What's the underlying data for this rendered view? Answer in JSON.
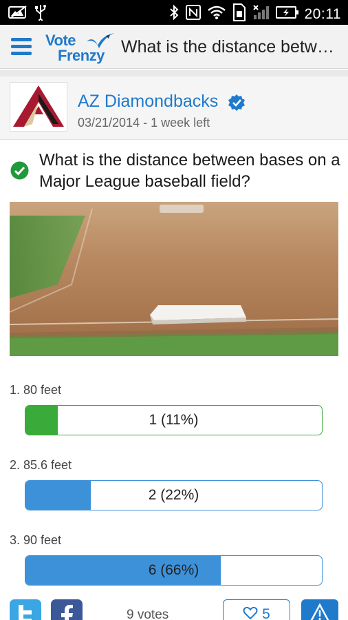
{
  "status_bar": {
    "time": "20:11",
    "left_icons": [
      "image-icon",
      "usb-icon"
    ],
    "right_icons": [
      "bluetooth-icon",
      "nfc-icon",
      "wifi-icon",
      "sim-icon",
      "signal-icon",
      "battery-charging-icon"
    ]
  },
  "app_bar": {
    "logo_line1": "Vote",
    "logo_line2": "Frenzy",
    "title": "What is the distance betwe…"
  },
  "poll": {
    "author": "AZ Diamondbacks",
    "meta": "03/21/2014 - 1 week left",
    "question": "What is the distance between bases on a Major League baseball field?",
    "options": [
      {
        "label": "1. 80 feet",
        "result": "1 (11%)",
        "fraction": 0.11,
        "color": "#3aaa3a",
        "voted": true
      },
      {
        "label": "2. 85.6 feet",
        "result": "2 (22%)",
        "fraction": 0.22,
        "color": "#3d91d9",
        "voted": false
      },
      {
        "label": "3. 90 feet",
        "result": "6 (66%)",
        "fraction": 0.66,
        "color": "#3d91d9",
        "voted": false
      }
    ]
  },
  "footer": {
    "votes": "9 votes",
    "likes": "5",
    "twitter_icon": "twitter-icon",
    "facebook_icon": "facebook-icon",
    "report_icon": "warning-icon"
  },
  "colors": {
    "accent": "#1f7acc",
    "correct": "#3aaa3a",
    "bar": "#3d91d9"
  }
}
